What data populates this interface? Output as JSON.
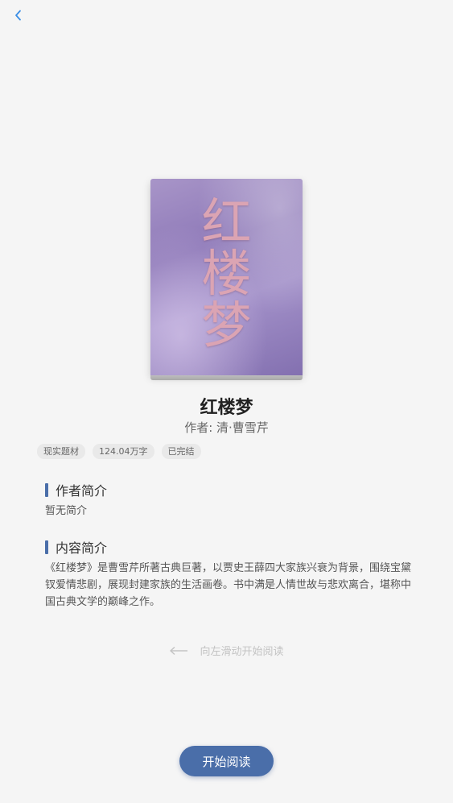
{
  "book": {
    "cover_title_chars": [
      "红",
      "楼",
      "梦"
    ],
    "title": "红楼梦",
    "author": "作者: 清·曹雪芹",
    "tags": [
      "现实题材",
      "124.04万字",
      "已完结"
    ]
  },
  "author_section": {
    "heading": "作者简介",
    "text": "暂无简介"
  },
  "content_section": {
    "heading": "内容简介",
    "text": "《红楼梦》是曹雪芹所著古典巨著，以贾史王薛四大家族兴衰为背景，围绕宝黛钗爱情悲剧，展现封建家族的生活画卷。书中满是人情世故与悲欢离合，堪称中国古典文学的巅峰之作。"
  },
  "swipe_hint": "向左滑动开始阅读",
  "start_button": "开始阅读",
  "icons": {
    "back": "chevron-left-icon",
    "swipe": "arrow-left-icon"
  },
  "colors": {
    "accent": "#4a6ea9",
    "back_icon": "#3a8ee6",
    "background": "#f5f5f5"
  }
}
